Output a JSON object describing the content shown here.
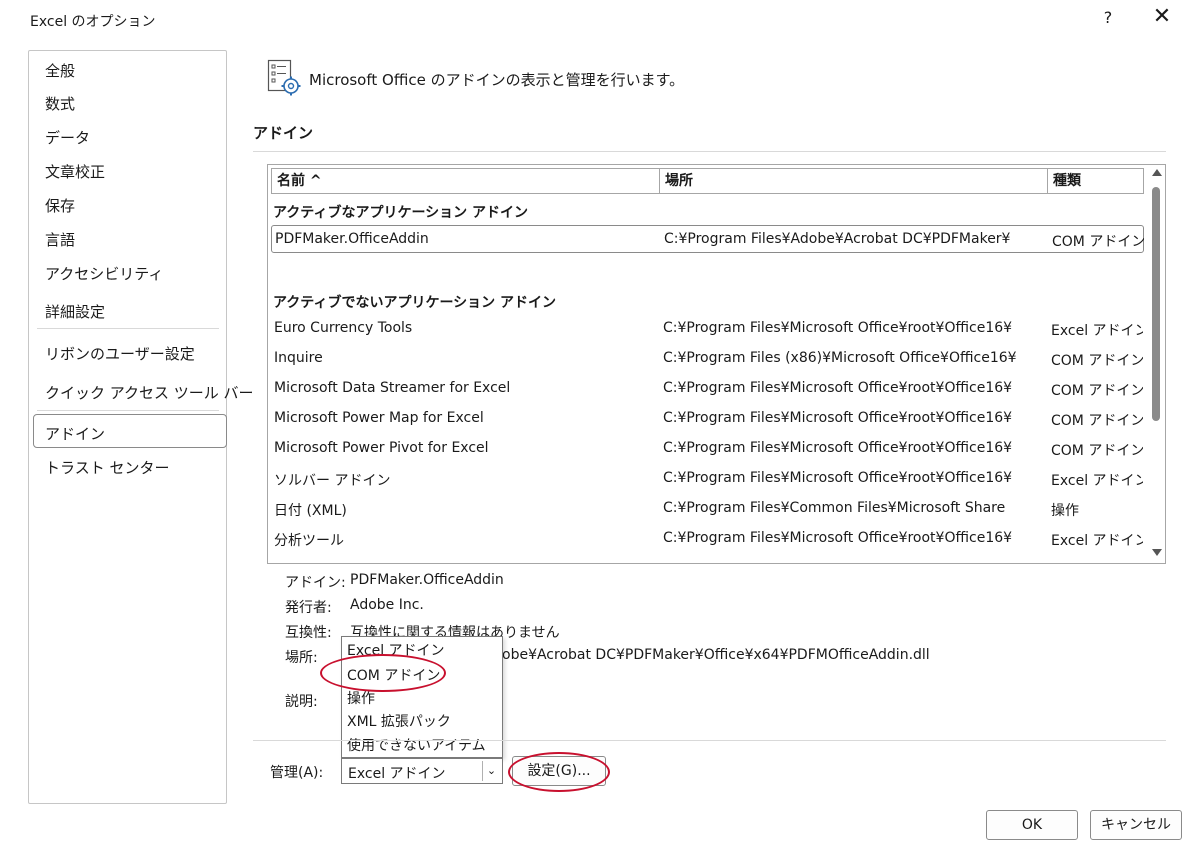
{
  "window": {
    "title": "Excel のオプション",
    "help_label": "?",
    "close_label": "✕"
  },
  "sidebar": {
    "items": [
      {
        "label": "全般"
      },
      {
        "label": "数式"
      },
      {
        "label": "データ"
      },
      {
        "label": "文章校正"
      },
      {
        "label": "保存"
      },
      {
        "label": "言語"
      },
      {
        "label": "アクセシビリティ"
      },
      {
        "label": "詳細設定"
      },
      {
        "label": "リボンのユーザー設定"
      },
      {
        "label": "クイック アクセス ツール バー"
      },
      {
        "label": "アドイン",
        "selected": true
      },
      {
        "label": "トラスト センター"
      }
    ]
  },
  "main": {
    "header_text": "Microsoft Office のアドインの表示と管理を行います。",
    "section_title": "アドイン",
    "columns": {
      "name": "名前 ^",
      "location": "場所",
      "type": "種類"
    },
    "active_group_title": "アクティブなアプリケーション アドイン",
    "active_rows": [
      {
        "name": "PDFMaker.OfficeAddin",
        "location": "C:¥Program Files¥Adobe¥Acrobat DC¥PDFMaker¥",
        "type": "COM アドイン"
      }
    ],
    "inactive_group_title": "アクティブでないアプリケーション アドイン",
    "inactive_rows": [
      {
        "name": "Euro Currency Tools",
        "location": "C:¥Program Files¥Microsoft Office¥root¥Office16¥",
        "type": "Excel アドイン"
      },
      {
        "name": "Inquire",
        "location": "C:¥Program Files (x86)¥Microsoft Office¥Office16¥",
        "type": "COM アドイン"
      },
      {
        "name": "Microsoft Data Streamer for Excel",
        "location": "C:¥Program Files¥Microsoft Office¥root¥Office16¥",
        "type": "COM アドイン"
      },
      {
        "name": "Microsoft Power Map for Excel",
        "location": "C:¥Program Files¥Microsoft Office¥root¥Office16¥",
        "type": "COM アドイン"
      },
      {
        "name": "Microsoft Power Pivot for Excel",
        "location": "C:¥Program Files¥Microsoft Office¥root¥Office16¥",
        "type": "COM アドイン"
      },
      {
        "name": "ソルバー アドイン",
        "location": "C:¥Program Files¥Microsoft Office¥root¥Office16¥",
        "type": "Excel アドイン"
      },
      {
        "name": "日付 (XML)",
        "location": "C:¥Program Files¥Common Files¥Microsoft Share",
        "type": "操作"
      },
      {
        "name": "分析ツール",
        "location": "C:¥Program Files¥Microsoft Office¥root¥Office16¥",
        "type": "Excel アドイン"
      }
    ]
  },
  "details": {
    "addin_label": "アドイン:",
    "addin_value": "PDFMaker.OfficeAddin",
    "publisher_label": "発行者:",
    "publisher_value": "Adobe Inc.",
    "compat_label": "互換性:",
    "compat_value": "互換性に関する情報はありません",
    "location_label": "場所:",
    "location_value": "obe¥Acrobat DC¥PDFMaker¥Office¥x64¥PDFMOfficeAddin.dll",
    "description_label": "説明:"
  },
  "manage": {
    "label": "管理(A):",
    "selected": "Excel アドイン",
    "arrow": "⌄",
    "options": [
      "Excel アドイン",
      "COM アドイン",
      "操作",
      "XML 拡張パック",
      "使用できないアイテム"
    ],
    "settings_button": "設定(G)..."
  },
  "buttons": {
    "ok": "OK",
    "cancel": "キャンセル"
  },
  "annotation_color": "#c8102e"
}
